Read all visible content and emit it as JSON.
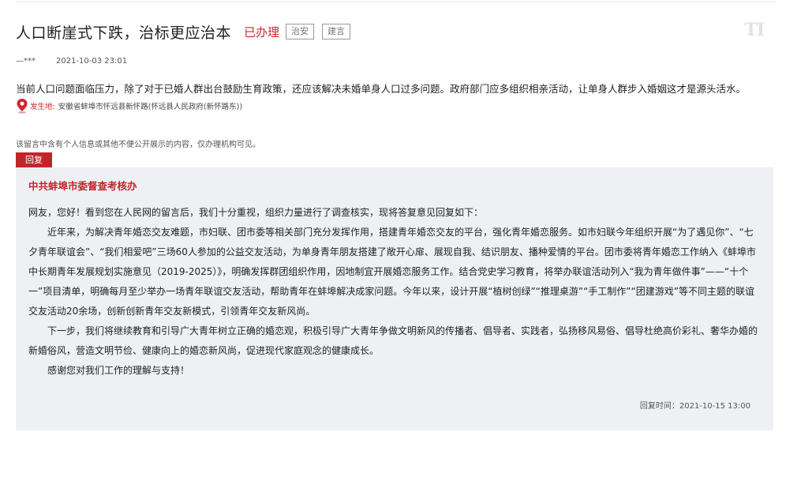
{
  "message": {
    "title": "人口断崖式下跌，治标更应治本",
    "status": "已办理",
    "tags": [
      "治安",
      "建言"
    ],
    "author": "—***",
    "date": "2021-10-03 23:01",
    "content": "当前人口问题面临压力，除了对于已婚人群出台鼓励生育政策，还应该解决未婚单身人口过多问题。政府部门应多组织相亲活动，让单身人群步入婚姻这才是源头活水。",
    "location_label": "发生地:",
    "location": "安徽省蚌埠市怀远县新怀路(怀远县人民政府(新怀路东))",
    "notice": "该留言中含有个人信息或其他不便公开展示的内容，仅办理机构可见。"
  },
  "corner_logo": "TI",
  "reply": {
    "tab_label": "回复",
    "org": "中共蚌埠市委督查考核办",
    "greeting": "网友，您好！看到您在人民网的留言后，我们十分重视，组织力量进行了调查核实，现将答复意见回复如下：",
    "paragraph1": "近年来，为解决青年婚恋交友难题，市妇联、团市委等相关部门充分发挥作用，搭建青年婚恋交友的平台，强化青年婚恋服务。如市妇联今年组织开展“为了遇见你”、“七夕青年联谊会”、“我们相爱吧”三场60人参加的公益交友活动，为单身青年朋友搭建了敞开心扉、展现自我、结识朋友、播种爱情的平台。团市委将青年婚恋工作纳入《蚌埠市中长期青年发展规划实施意见（2019-2025）》，明确发挥群团组织作用，因地制宜开展婚恋服务工作。结合党史学习教育，将举办联谊活动列入“我为青年做件事”——“十个一”项目清单，明确每月至少举办一场青年联谊交友活动，帮助青年在蚌埠解决成家问题。今年以来，设计开展“植树创绿”“推理桌游”“手工制作”“团建游戏”等不同主题的联谊交友活动20余场，创新创新青年交友新模式，引领青年交友新风尚。",
    "paragraph2": "下一步，我们将继续教育和引导广大青年树立正确的婚恋观，积极引导广大青年争做文明新风的传播者、倡导者、实践者，弘扬移风易俗、倡导杜绝高价彩礼、奢华办婚的新婚俗风，营造文明节俭、健康向上的婚恋新风尚，促进现代家庭观念的健康成长。",
    "closing": "感谢您对我们工作的理解与支持！",
    "time": "回复时间：2021-10-15 13:00"
  },
  "colors": {
    "accent": "#c3242a",
    "reply_bg": "#eef0f4"
  },
  "icons": {
    "location": "map-pin-icon"
  }
}
